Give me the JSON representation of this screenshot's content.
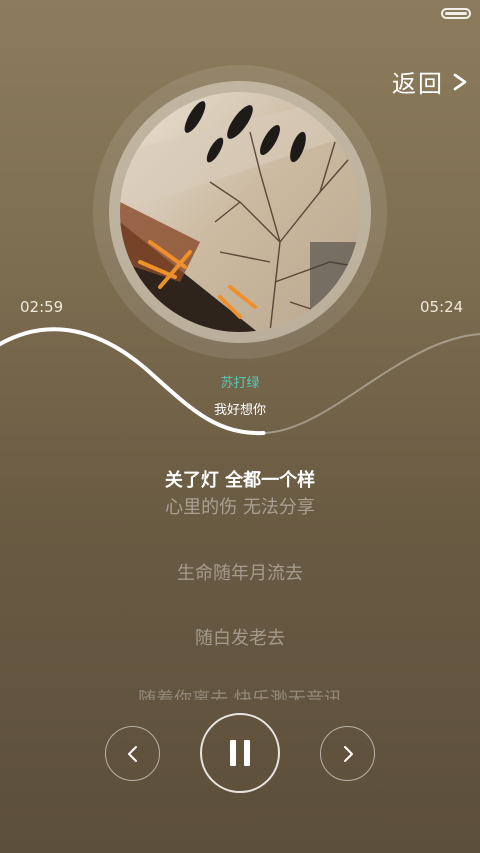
{
  "status_bar": {
    "battery_level": 1.0
  },
  "header": {
    "back_label": "返回"
  },
  "player": {
    "elapsed": "02:59",
    "total": "05:24",
    "progress": 0.552,
    "artist": "苏打绿",
    "song_title": "我好想你"
  },
  "lyrics": {
    "current": "关了灯 全都一个样",
    "lines": [
      "心里的伤 无法分享",
      "生命随年月流去",
      "随白发老去",
      "随着你离去 快乐渺无音讯"
    ]
  },
  "controls": {
    "prev_icon": "chevron-left-icon",
    "pause_icon": "pause-icon",
    "next_icon": "chevron-right-icon"
  },
  "colors": {
    "accent": "#57c9b4",
    "background_top": "#8c7b5c",
    "background_bottom": "#5c4f3b"
  }
}
